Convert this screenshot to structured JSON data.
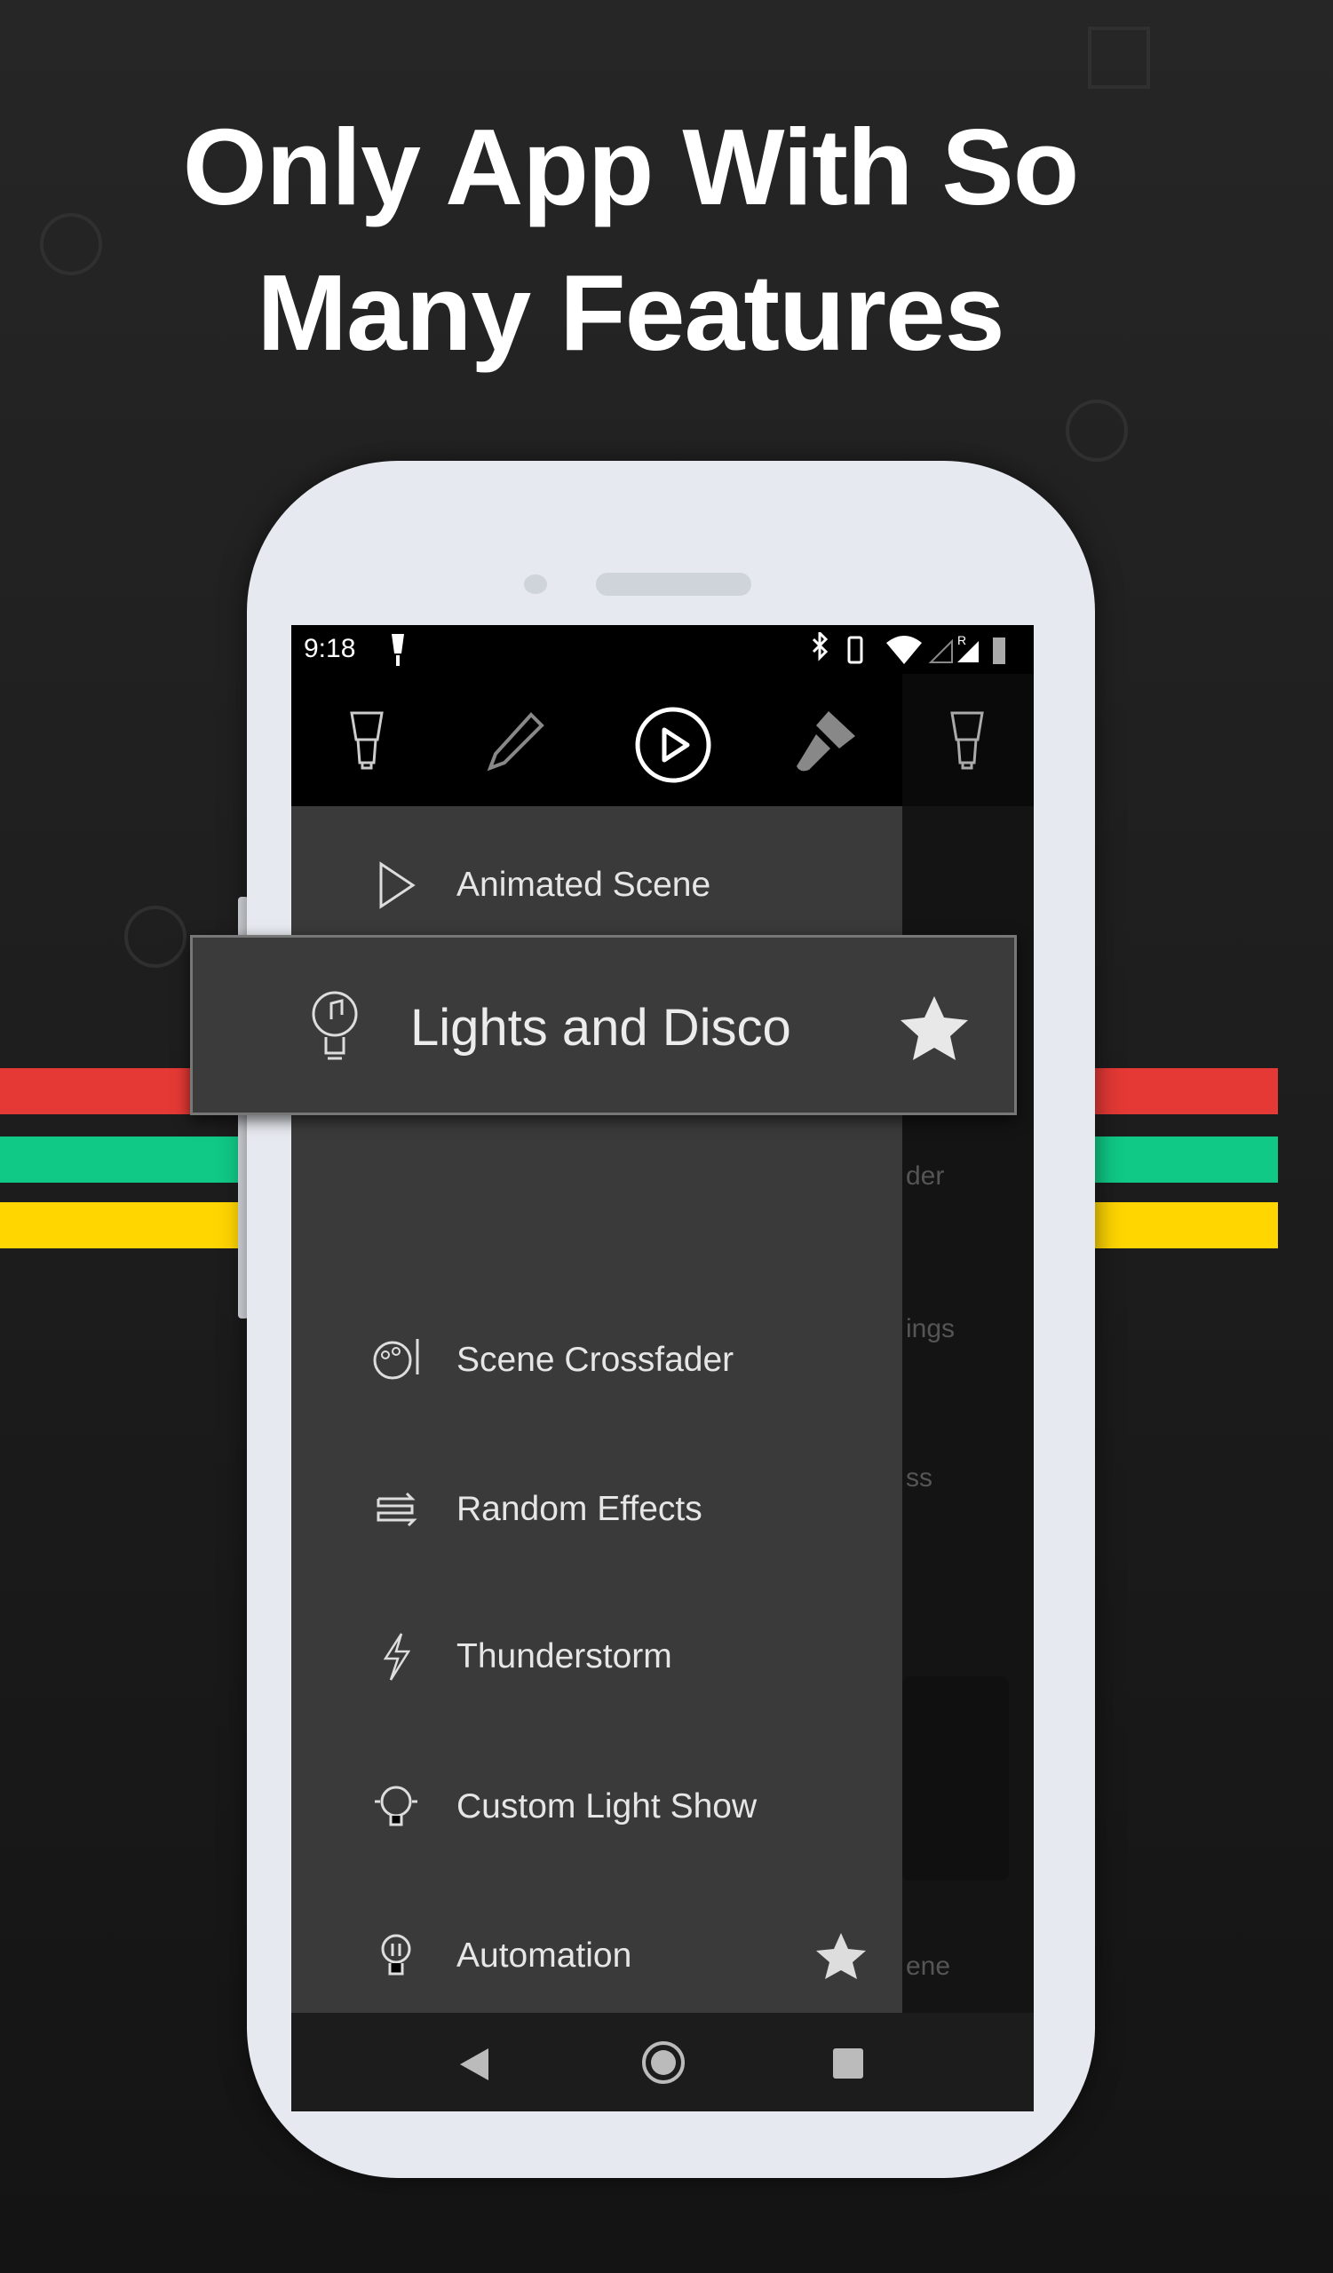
{
  "headline": {
    "line1": "Only App With So",
    "line2": "Many Features"
  },
  "colors": {
    "stripe_red": "#e53935",
    "stripe_green": "#10c987",
    "stripe_yellow": "#ffd600",
    "drawer": "#3a3a3a"
  },
  "status_bar": {
    "time": "9:18",
    "icons": [
      "lamp-icon",
      "bluetooth-icon",
      "vibrate-icon",
      "wifi-icon",
      "signal-icon",
      "signal-roaming-icon",
      "battery-charging-icon"
    ],
    "roaming": "R"
  },
  "toolbar": {
    "icons": [
      "bulb-icon",
      "pencil-icon",
      "play-circle-icon",
      "paintbrush-icon",
      "bulb-icon"
    ],
    "active": "play-circle-icon"
  },
  "drawer": {
    "items": [
      {
        "label": "Animated Scene",
        "icon": "play-icon"
      },
      {
        "label": "Lights and Disco",
        "icon": "music-bulb-icon",
        "favorite": true,
        "highlighted": true
      },
      {
        "label": "Scene Crossfader",
        "icon": "palette-icon"
      },
      {
        "label": "Random Effects",
        "icon": "shuffle-icon"
      },
      {
        "label": "Thunderstorm",
        "icon": "lightning-icon"
      },
      {
        "label": "Custom Light Show",
        "icon": "brain-bulb-icon"
      },
      {
        "label": "Automation",
        "icon": "bulb-icon",
        "favorite": true
      }
    ]
  },
  "background_app": {
    "fragments": [
      "der",
      "ings",
      "ss",
      "ene"
    ]
  },
  "nav_bar": [
    "back",
    "home",
    "recents"
  ]
}
